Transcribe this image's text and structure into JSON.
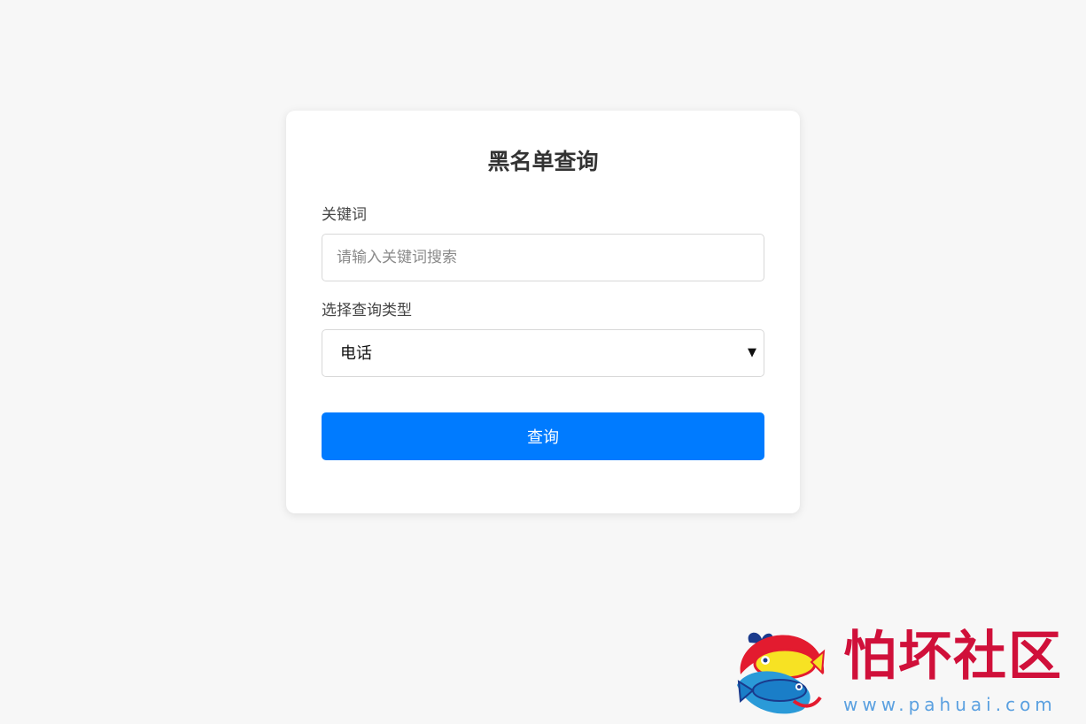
{
  "form": {
    "title": "黑名单查询",
    "keyword_label": "关键词",
    "keyword_placeholder": "请输入关键词搜索",
    "keyword_value": "",
    "type_label": "选择查询类型",
    "type_selected": "电话",
    "type_arrow_icon": "dropdown-caret-icon",
    "submit_label": "查询"
  },
  "watermark": {
    "name": "怕坏社区",
    "url": "www.pahuai.com"
  },
  "colors": {
    "background": "#f7f7f7",
    "card": "#ffffff",
    "button": "#007bff",
    "watermark_red": "#d0103a",
    "watermark_blue": "#5aa0e0"
  }
}
